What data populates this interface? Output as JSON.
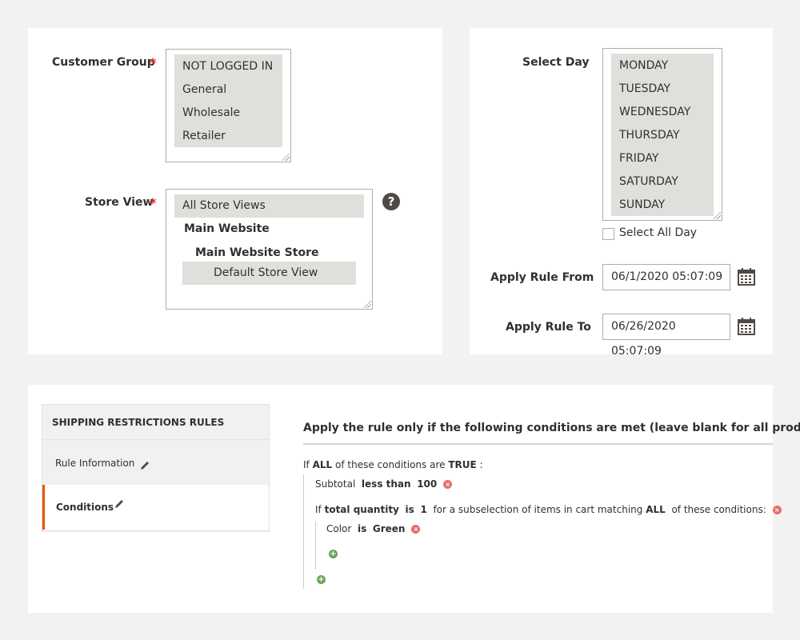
{
  "customer_group": {
    "label": "Customer Group",
    "required_mark": "*",
    "options": [
      "NOT LOGGED IN",
      "General",
      "Wholesale",
      "Retailer"
    ]
  },
  "store_view": {
    "label": "Store View",
    "required_mark": "*",
    "help": "?",
    "all": "All Store Views",
    "website": "Main Website",
    "store": "Main Website Store",
    "view": "Default Store View"
  },
  "select_day": {
    "label": "Select Day",
    "options": [
      "MONDAY",
      "TUESDAY",
      "WEDNESDAY",
      "THURSDAY",
      "FRIDAY",
      "SATURDAY",
      "SUNDAY"
    ],
    "select_all_label": "Select All Day"
  },
  "apply_from": {
    "label": "Apply Rule From",
    "value": "06/1/2020 05:07:09"
  },
  "apply_to": {
    "label": "Apply Rule To",
    "value": "06/26/2020 05:07:09"
  },
  "tabs": {
    "header": "SHIPPING RESTRICTIONS RULES",
    "rule_info": "Rule Information",
    "conditions": "Conditions"
  },
  "conditions": {
    "title": "Apply the rule only if the following conditions are met (leave blank for all products).",
    "l1_if": "If",
    "l1_all": "ALL",
    "l1_mid": "of these conditions are",
    "l1_true": "TRUE",
    "l1_end": ":",
    "l2_attr": "Subtotal",
    "l2_op": "less than",
    "l2_val": "100",
    "l3_if": "If",
    "l3_attr": "total quantity",
    "l3_op": "is",
    "l3_val": "1",
    "l3_mid": "for a subselection of items in cart matching",
    "l3_all": "ALL",
    "l3_end": "of these conditions:",
    "l4_attr": "Color",
    "l4_op": "is",
    "l4_val": "Green"
  },
  "colors": {
    "accent": "#eb5202",
    "required": "#e22626",
    "selected": "#e1dfdc"
  }
}
